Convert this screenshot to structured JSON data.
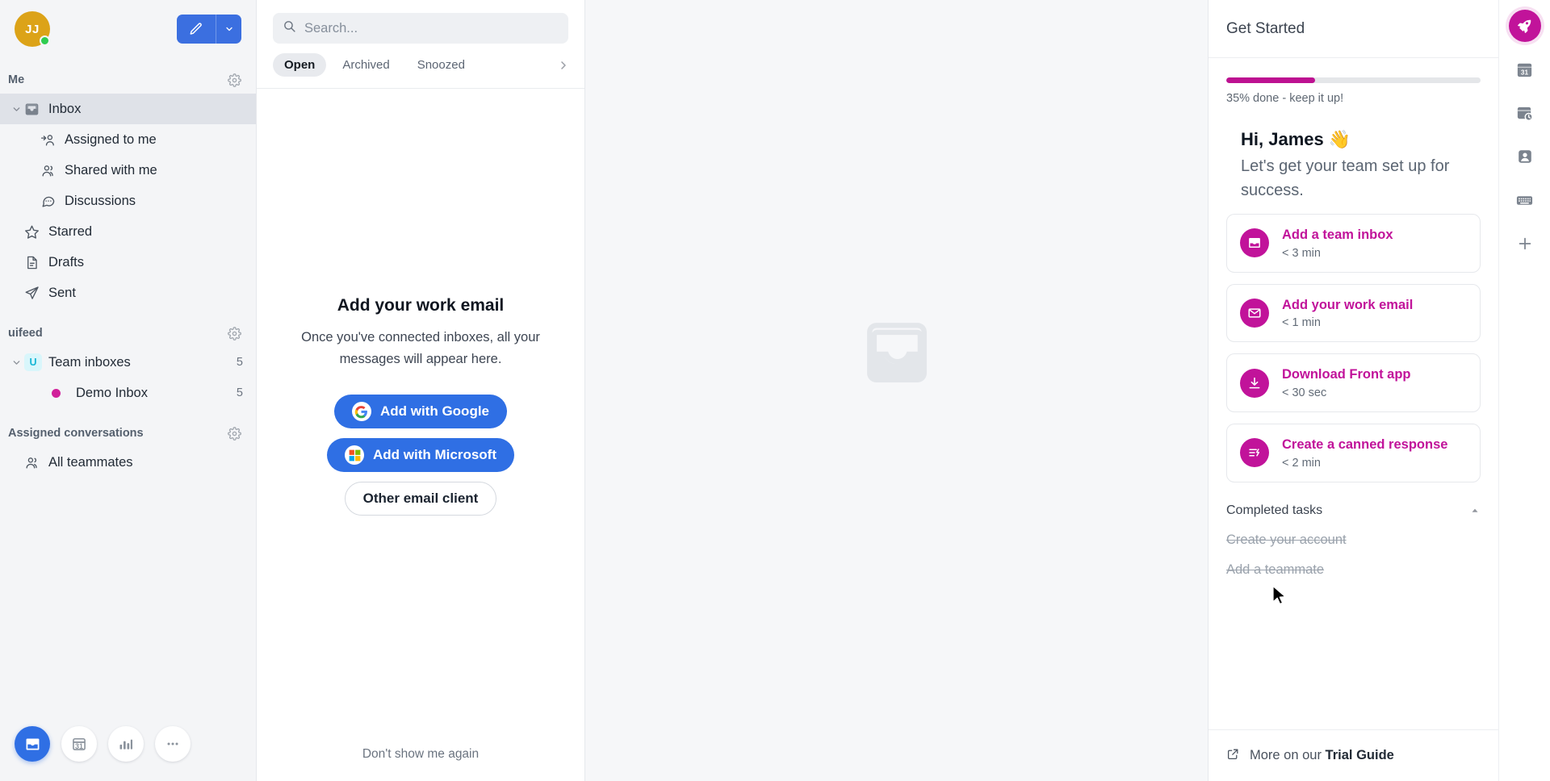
{
  "sidebar": {
    "avatar_initials": "JJ",
    "sections": [
      {
        "title": "Me"
      },
      {
        "title": "uifeed"
      },
      {
        "title": "Assigned conversations"
      }
    ],
    "me_items": [
      {
        "label": "Inbox",
        "icon": "inbox-icon",
        "count": ""
      },
      {
        "label": "Assigned to me",
        "icon": "assigned-user-icon",
        "count": ""
      },
      {
        "label": "Shared with me",
        "icon": "shared-users-icon",
        "count": ""
      },
      {
        "label": "Discussions",
        "icon": "chat-bubble-icon",
        "count": ""
      },
      {
        "label": "Starred",
        "icon": "star-icon",
        "count": ""
      },
      {
        "label": "Drafts",
        "icon": "draft-document-icon",
        "count": ""
      },
      {
        "label": "Sent",
        "icon": "paper-plane-icon",
        "count": ""
      }
    ],
    "team_items": [
      {
        "label": "Team inboxes",
        "count": "5"
      },
      {
        "label": "Demo Inbox",
        "count": "5"
      }
    ],
    "assigned_items": [
      {
        "label": "All teammates",
        "icon": "teammates-icon"
      }
    ],
    "footer_buttons": [
      {
        "name": "inbox-app-button",
        "icon": "inbox-icon"
      },
      {
        "name": "calendar-app-button",
        "icon": "calendar-icon"
      },
      {
        "name": "analytics-app-button",
        "icon": "bar-chart-icon"
      },
      {
        "name": "more-apps-button",
        "icon": "ellipsis-icon"
      }
    ]
  },
  "list": {
    "search_placeholder": "Search...",
    "search_value": "",
    "tabs": [
      {
        "label": "Open",
        "active": true
      },
      {
        "label": "Archived",
        "active": false
      },
      {
        "label": "Snoozed",
        "active": false
      }
    ],
    "empty": {
      "title": "Add your work email",
      "subtitle": "Once you've connected inboxes, all your messages will appear here.",
      "google_button": "Add with Google",
      "microsoft_button": "Add with Microsoft",
      "other_button": "Other email client"
    },
    "dont_show": "Don't show me again"
  },
  "right_panel": {
    "title": "Get Started",
    "progress_percent": 35,
    "progress_label": "35% done - keep it up!",
    "greeting_heading": "Hi, James 👋",
    "greeting_sub": "Let's get your team set up for success.",
    "tasks": [
      {
        "title": "Add a team inbox",
        "time": "< 3 min",
        "icon": "team-inbox-icon"
      },
      {
        "title": "Add your work email",
        "time": "< 1 min",
        "icon": "envelope-icon"
      },
      {
        "title": "Download Front app",
        "time": "< 30 sec",
        "icon": "download-icon"
      },
      {
        "title": "Create a canned response",
        "time": "< 2 min",
        "icon": "canned-response-icon"
      }
    ],
    "completed_heading": "Completed tasks",
    "completed": [
      {
        "label": "Create your account"
      },
      {
        "label": "Add a teammate"
      }
    ],
    "footer_prefix": "More on our ",
    "footer_link": "Trial Guide"
  },
  "rail": {
    "items": [
      {
        "name": "rocket-icon",
        "active": true
      },
      {
        "name": "calendar-31-icon",
        "active": false
      },
      {
        "name": "snooze-clock-icon",
        "active": false
      },
      {
        "name": "contacts-icon",
        "active": false
      },
      {
        "name": "keyboard-icon",
        "active": false
      },
      {
        "name": "plus-icon",
        "active": false
      }
    ]
  },
  "colors": {
    "accent_blue": "#2f6fe4",
    "accent_magenta": "#c1139a",
    "avatar_gold": "#dca318",
    "presence_green": "#2ecc50"
  }
}
